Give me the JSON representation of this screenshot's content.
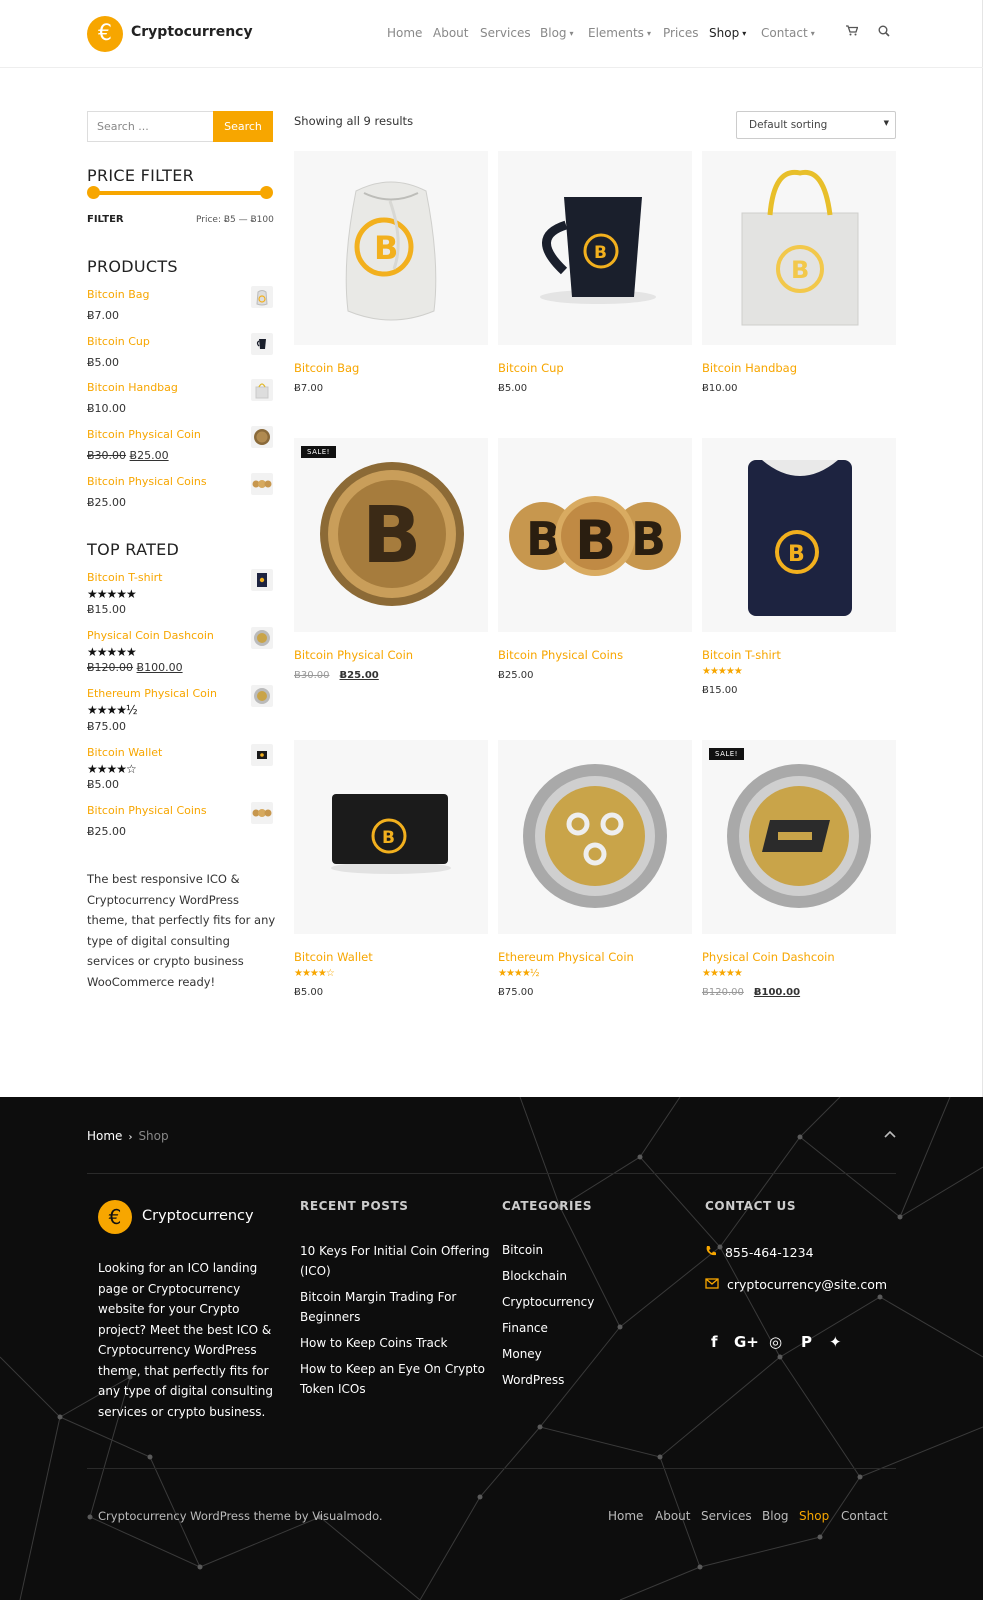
{
  "header": {
    "logo_symbol": "€",
    "logo_text": "Cryptocurrency",
    "nav": [
      {
        "label": "Home",
        "dropdown": false
      },
      {
        "label": "About",
        "dropdown": false
      },
      {
        "label": "Services",
        "dropdown": false
      },
      {
        "label": "Blog",
        "dropdown": true
      },
      {
        "label": "Elements",
        "dropdown": true
      },
      {
        "label": "Prices",
        "dropdown": false
      },
      {
        "label": "Shop",
        "dropdown": true,
        "active": true
      },
      {
        "label": "Contact",
        "dropdown": true
      }
    ],
    "cart_icon": "cart-icon",
    "search_icon": "search-icon"
  },
  "sidebar": {
    "search_placeholder": "Search ...",
    "search_button": "Search",
    "price_filter_title": "PRICE FILTER",
    "filter_button": "FILTER",
    "price_range": "Price: Ƀ5 — Ƀ100",
    "products_title": "PRODUCTS",
    "products": [
      {
        "name": "Bitcoin Bag",
        "price": "Ƀ7.00"
      },
      {
        "name": "Bitcoin Cup",
        "price": "Ƀ5.00"
      },
      {
        "name": "Bitcoin Handbag",
        "price": "Ƀ10.00"
      },
      {
        "name": "Bitcoin Physical Coin",
        "old_price": "Ƀ30.00",
        "price": "Ƀ25.00"
      },
      {
        "name": "Bitcoin Physical Coins",
        "price": "Ƀ25.00"
      }
    ],
    "top_rated_title": "TOP RATED",
    "top_rated": [
      {
        "name": "Bitcoin T-shirt",
        "stars": "★★★★★",
        "price": "Ƀ15.00"
      },
      {
        "name": "Physical Coin Dashcoin",
        "stars": "★★★★★",
        "old_price": "Ƀ120.00",
        "price": "Ƀ100.00"
      },
      {
        "name": "Ethereum Physical Coin",
        "stars": "★★★★½",
        "price": "Ƀ75.00"
      },
      {
        "name": "Bitcoin Wallet",
        "stars": "★★★★☆",
        "price": "Ƀ5.00"
      },
      {
        "name": "Bitcoin Physical Coins",
        "stars": "",
        "price": "Ƀ25.00"
      }
    ],
    "about_text": "The best responsive ICO & Cryptocurrency WordPress theme, that perfectly fits for any type of digital consulting services or crypto business WooCommerce ready!"
  },
  "shop": {
    "results_text": "Showing all 9 results",
    "sorting": "Default sorting",
    "products": [
      {
        "name": "Bitcoin Bag",
        "price": "Ƀ7.00",
        "stars": "",
        "sale": false
      },
      {
        "name": "Bitcoin Cup",
        "price": "Ƀ5.00",
        "stars": "",
        "sale": false
      },
      {
        "name": "Bitcoin Handbag",
        "price": "Ƀ10.00",
        "stars": "",
        "sale": false
      },
      {
        "name": "Bitcoin Physical Coin",
        "old_price": "Ƀ30.00",
        "price": "Ƀ25.00",
        "stars": "",
        "sale": true
      },
      {
        "name": "Bitcoin Physical Coins",
        "price": "Ƀ25.00",
        "stars": "",
        "sale": false
      },
      {
        "name": "Bitcoin T-shirt",
        "price": "Ƀ15.00",
        "stars": "★★★★★",
        "sale": false
      },
      {
        "name": "Bitcoin Wallet",
        "price": "Ƀ5.00",
        "stars": "★★★★☆",
        "sale": false
      },
      {
        "name": "Ethereum Physical Coin",
        "price": "Ƀ75.00",
        "stars": "★★★★½",
        "sale": false
      },
      {
        "name": "Physical Coin Dashcoin",
        "old_price": "Ƀ120.00",
        "price": "Ƀ100.00",
        "stars": "★★★★★",
        "sale": true
      }
    ],
    "sale_label": "SALE!"
  },
  "footer": {
    "breadcrumb_home": "Home",
    "breadcrumb_sep": "›",
    "breadcrumb_current": "Shop",
    "logo_symbol": "€",
    "logo_text": "Cryptocurrency",
    "about": "Looking for an ICO landing page or Cryptocurrency website for your Crypto project? Meet the best ICO & Cryptocurrency WordPress theme, that perfectly fits for any type of digital consulting services or crypto business.",
    "recent_posts_title": "RECENT POSTS",
    "recent_posts": [
      "10 Keys For Initial Coin Offering (ICO)",
      "Bitcoin Margin Trading For Beginners",
      "How to Keep Coins Track",
      "How to Keep an Eye On Crypto Token ICOs"
    ],
    "categories_title": "CATEGORIES",
    "categories": [
      "Bitcoin",
      "Blockchain",
      "Cryptocurrency",
      "Finance",
      "Money",
      "WordPress"
    ],
    "contact_title": "CONTACT US",
    "phone": "855-464-1234",
    "email": "cryptocurrency@site.com",
    "social": [
      "f",
      "G+",
      "◎",
      "P",
      "✦"
    ],
    "copyright": "Cryptocurrency WordPress theme by Visualmodo.",
    "nav": [
      "Home",
      "About",
      "Services",
      "Blog",
      "Shop",
      "Contact"
    ],
    "nav_active": "Shop"
  }
}
